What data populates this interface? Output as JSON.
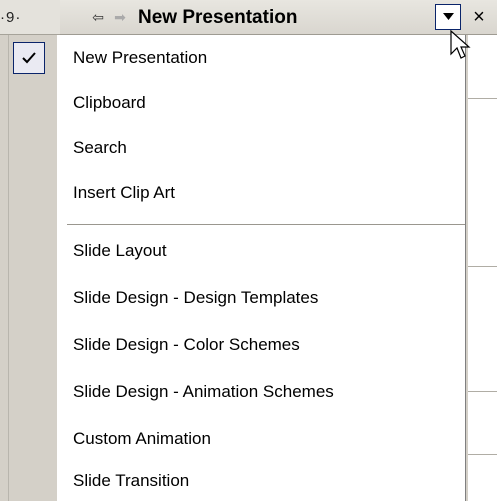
{
  "ruler": {
    "mark": "·9·"
  },
  "titlebar": {
    "back_icon": "left-arrow-icon",
    "forward_icon": "right-arrow-icon",
    "title": "New Presentation",
    "close_symbol": "×"
  },
  "menu": {
    "items": [
      {
        "label": "New Presentation",
        "checked": true
      },
      {
        "label": "Clipboard",
        "checked": false
      },
      {
        "label": "Search",
        "checked": false
      },
      {
        "label": "Insert Clip Art",
        "checked": false
      },
      {
        "label": "Slide Layout",
        "checked": false
      },
      {
        "label": "Slide Design - Design Templates",
        "checked": false
      },
      {
        "label": "Slide Design - Color Schemes",
        "checked": false
      },
      {
        "label": "Slide Design - Animation Schemes",
        "checked": false
      },
      {
        "label": "Custom Animation",
        "checked": false
      },
      {
        "label": "Slide Transition",
        "checked": false
      }
    ]
  },
  "colors": {
    "selection_border": "#0a246a",
    "menu_background": "#ffffff",
    "chrome": "#d4d0c8"
  }
}
